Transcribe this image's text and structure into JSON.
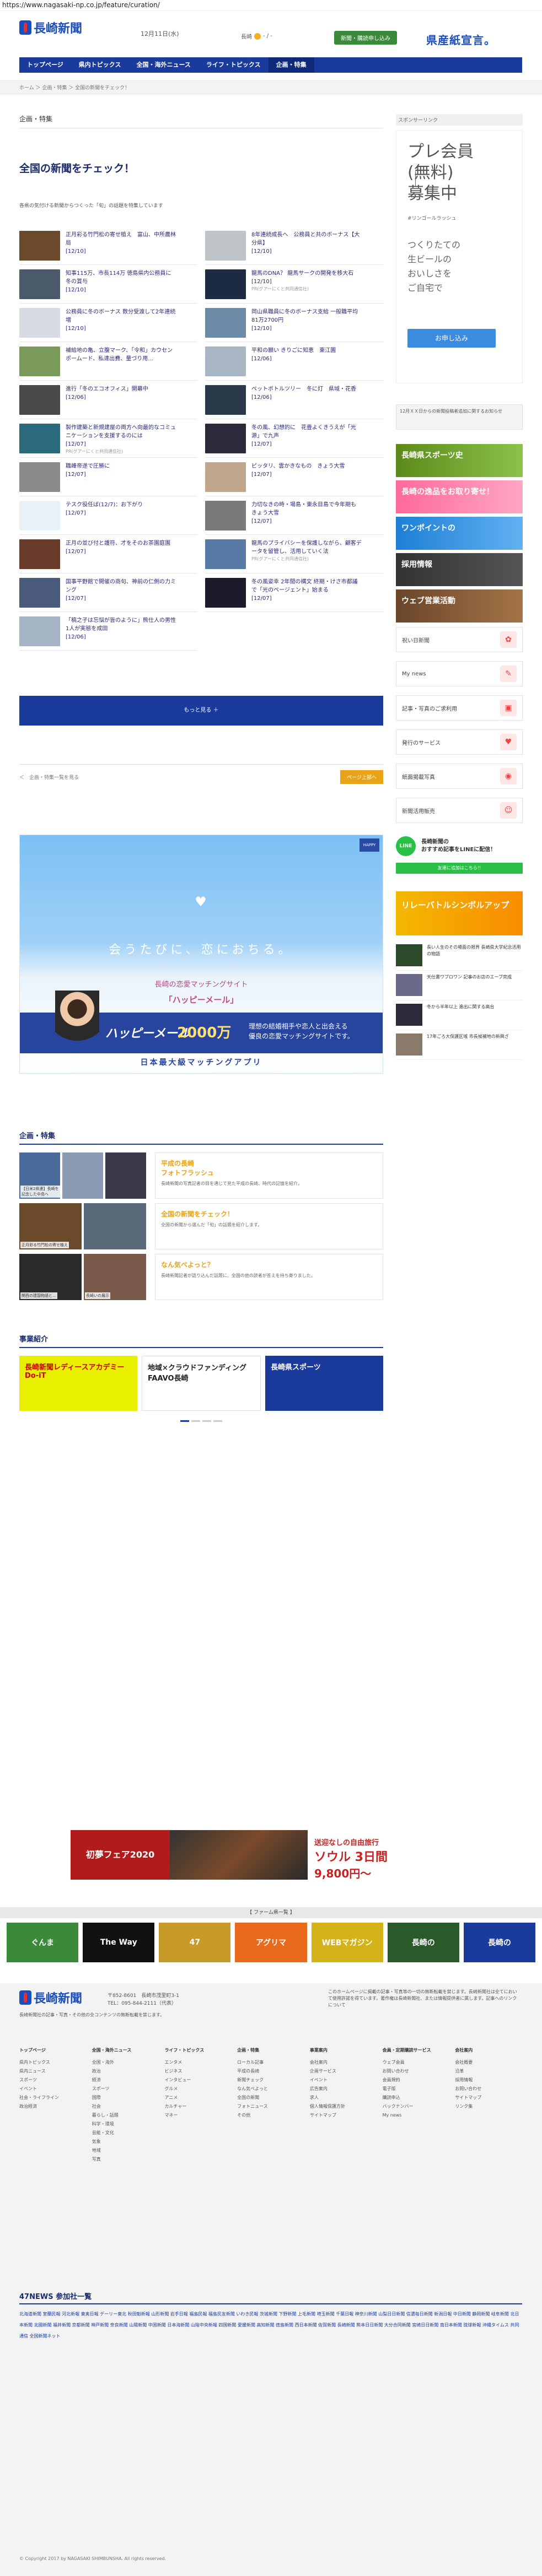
{
  "browser": {
    "url": "https://www.nagasaki-np.co.jp/feature/curation/"
  },
  "header": {
    "site_name": "長崎新聞",
    "date": "12月11日(水)",
    "weather": "長崎",
    "weather_temp": "- / -",
    "subscribe": "新聞・購読申し込み",
    "top_ad": "県産紙宣言。"
  },
  "nav": {
    "items": [
      "トップページ",
      "県内トピックス",
      "全国・海外ニュース",
      "ライフ・トピックス",
      "企画・特集"
    ],
    "side": [
      "会社案内",
      "事業案内"
    ]
  },
  "breadcrumb": "ホーム ＞ 企画・特集 ＞ 全国の新聞をチェック！",
  "main": {
    "category": "企画・特集",
    "title": "全国の新聞をチェック！",
    "lead": "各県の気付ける新聞からつくった「旬」の話題を特集しています",
    "cards": [
      {
        "title": "正月彩る竹門松の寄せ植え　富山、中所農林局",
        "date": "[12/10]",
        "color": "#6a4a2a"
      },
      {
        "title": "8年連続成長へ　公務員と共のボーナス【大分県】",
        "date": "[12/10]",
        "color": "#bfc4c8"
      },
      {
        "title": "知事115万、市長114万 徳島県内公務員に冬の賞与",
        "date": "[12/10]",
        "color": "#4a5a6a"
      },
      {
        "title": "龍馬のDNA？ 龍馬サークの開発を移大石",
        "date": "[12/10]",
        "color": "#1d2a44",
        "credit": "PR(グアーにくと共同通信社)"
      },
      {
        "title": "公務員に冬のボーナス 数分受渡して2年連続増",
        "date": "[12/10]",
        "color": "#d6dbe4"
      },
      {
        "title": "岡山県職員に冬のボーナス支給 一般職平均81万2700円",
        "date": "[12/10]",
        "color": "#6a8aa6"
      },
      {
        "title": "補給地の亀、立腹マーク、「令和」カウセンポームード、私達出費、量づり用...",
        "date": "",
        "color": "#7a9a5a"
      },
      {
        "title": "平和の願い きりごに知恵　東江園",
        "date": "[12/06]",
        "color": "#a9b6c4"
      },
      {
        "title": "進行「冬のエコオフィス」開幕中",
        "date": "[12/06]",
        "color": "#4a4a4a"
      },
      {
        "title": "ペットボトルツリー　冬に灯　県域・花香",
        "date": "[12/06]",
        "color": "#2a3a4a"
      },
      {
        "title": "製作建築と新規建屋の両方へ向最的なコミュニケーションを支援するのには",
        "date": "[12/07]",
        "color": "#2a6a7a",
        "credit": "PR(グアーにくと共同通信社)"
      },
      {
        "title": "冬の風、幻想的に　花畳よくきうえが「光源」で九声",
        "date": "[12/07]",
        "color": "#2a2a3a"
      },
      {
        "title": "職峰帝遂で圧勝に",
        "date": "[12/07]",
        "color": "#8a8a8a"
      },
      {
        "title": "ピッタリ、雲かきなもの　きょう大雪",
        "date": "[12/07]",
        "color": "#c0a68a"
      },
      {
        "title": "テスク役任ば(12/7)：お下がり",
        "date": "[12/07]",
        "color": "#e8f0f8"
      },
      {
        "title": "力切なきの時・場島・東永目島で今年期も　きょう大雪",
        "date": "[12/07]",
        "color": "#7a7a7a"
      },
      {
        "title": "正月の並び付と護符、才をそのお茶園庭園",
        "date": "[12/07]",
        "color": "#6a3a2a"
      },
      {
        "title": "龍馬のプライバシーを保護しながら、顧客データを留管し、活用していく法",
        "date": "",
        "color": "#5a7aa6",
        "credit": "PR(グアーにくと共同通信社)"
      },
      {
        "title": "国事平野館で開催の商句、神前の仁側の力ミング",
        "date": "[12/07]",
        "color": "#4a5a7a"
      },
      {
        "title": "冬の風姿幸 2年間の構文 終期・けさ市都議で「光のページェント」始まる",
        "date": "[12/07]",
        "color": "#1a1a2a"
      },
      {
        "title": "「稿之子は忘悩が皆のように」熊仕人の男性1人が実態を成田",
        "date": "[12/06]",
        "color": "#a4b4c4"
      }
    ],
    "more": "もっと見る ＋",
    "pager_crumb": "＜　企画・特集一覧を見る",
    "pager_top": "ページ上部へ"
  },
  "banner": {
    "copy": "会うたびに、恋におちる。",
    "sub": "長崎の恋愛マッチングサイト",
    "brand": "「ハッピーメール」",
    "hm": "ハッピーメール",
    "num": "2000万",
    "desc": "理想の結婚相手や恋人と出会える\n優良の恋愛マッチングサイトです。",
    "foot": "日本最大級マッチングアプリ",
    "logo": "HAPPY"
  },
  "feature": {
    "heading": "企画・特集",
    "items": [
      {
        "title": "平成の長崎\nフォトフラッシュ",
        "desc": "長崎新聞の写真記者の目を通じて見た平成の長崎、時代の記憶を紹介。"
      },
      {
        "title": "全国の新聞をチェック！",
        "desc": "全国の新聞から選んだ「旬」の話題を紹介します。"
      },
      {
        "title": "なん気べよっと？",
        "desc": "長崎新聞記者が語り込んだ話題に、全国の他の読者が答えを持ち寄りました。"
      }
    ],
    "captions": [
      "【日米2県連】長崎を記念した中島へ",
      "正月彩る竹門松の寄せ植え",
      "関西の建国物語と…",
      "長崎いの展示"
    ]
  },
  "business": {
    "heading": "事業紹介",
    "items": [
      "長崎新聞レディースアカデミー Do-iT",
      "地域×クラウドファンディング FAAVO長崎",
      "長崎県スポーツ"
    ]
  },
  "sidebar": {
    "sponsor": "スポンサーリンク",
    "ad1": "プレ会員\n(無料)\n募集中",
    "ad1_brand": "#リンゴールラッシュ",
    "ad1_copy": "つくりたての\n生ビールの\nおいしさを\nご自宅で",
    "ad1_btn": "お申し込み",
    "notice": "12月ＸＸ日からの新聞投稿者追加に関するお知らせ",
    "sads": [
      "長崎県スポーツ史",
      "長崎の逸品をお取り寄せ！",
      "ワンポイントの",
      "採用情報",
      "ウェブ営業活動"
    ],
    "links": [
      "祝い日新聞",
      "My news",
      "記事・写真のご求利用",
      "発行のサービス",
      "紙面掲載写真",
      "新聞活用販売"
    ],
    "line_title": "長崎新聞の\nおすすめ記事をLINEに配信！",
    "line_btn": "友達に追加はこちら!!",
    "shimpro": "リレーバトルシンボルアップ",
    "mini": [
      "長い人生のその場面の限界 長崎県大学紀念活用の物語",
      "天仕書ワブロワン 記事のお店のエーブ完成",
      "冬から半年以上 進出に関する高台",
      "17年ごろ大保護区域 市長候補地の新興ざ"
    ]
  },
  "bottom_ad": {
    "l": "初夢フェア2020",
    "r1": "送迎なしの自由旅行",
    "r2": "ソウル 3日間",
    "r3": "9,800円〜"
  },
  "portal_bar": "【 ファーム県一覧 】",
  "portal": [
    "ぐんま",
    "The Way",
    "47",
    "アグリマ",
    "WEBマガジン",
    "長崎の",
    "長崎の"
  ],
  "footer": {
    "site_name": "長崎新聞",
    "addr": "〒852-8601　長崎市茂里町3-1\nTEL：095-844-2111（代表）",
    "note": "長崎新聞社の記事・写真・その他の全コンテンツの無断転載を禁じます。",
    "right": "このホームページに掲載の記事・写真等の一切の無断転載を禁じます。長崎新聞社は全てにおいて使用許諾を得ています。著作権は長崎新聞社、または情報提供者に属します。記事へのリンクについて",
    "cols": [
      {
        "h": "トップページ",
        "items": [
          "県内トピックス",
          "県内ニュース",
          "スポーツ",
          "イベント",
          "社会・ライフライン",
          "政治経済"
        ]
      },
      {
        "h": "全国・海外ニュース",
        "items": [
          "全国・海外",
          "政治",
          "経済",
          "スポーツ",
          "国際",
          "社会",
          "暮らし・話題",
          "科学・環境",
          "芸能・文化",
          "気象",
          "地域",
          "写真"
        ]
      },
      {
        "h": "ライフ・トピックス",
        "items": [
          "エンタメ",
          "ビジネス",
          "インタビュー",
          "グルメ",
          "アニメ",
          "カルチャー",
          "マネー"
        ]
      },
      {
        "h": "企画・特集",
        "items": [
          "ローカル記事",
          "平成の長崎",
          "新聞チェック",
          "なん気べよっと",
          "全国の新聞",
          "フォトニュース",
          "その他"
        ]
      },
      {
        "h": "事業案内",
        "items": [
          "会社案内",
          "企画サービス",
          "イベント",
          "広告案内",
          "求人",
          "個人情報保護方針",
          "サイトマップ"
        ]
      },
      {
        "h": "会員・定期購読サービス",
        "items": [
          "ウェブ会員",
          "お問い合わせ",
          "会員規約",
          "電子版",
          "購読申込",
          "バックナンバー",
          "My news"
        ]
      },
      {
        "h": "会社案内",
        "items": [
          "会社概要",
          "沿革",
          "採用情報",
          "お問い合わせ",
          "サイトマップ",
          "リンク集"
        ]
      }
    ],
    "n47": "47NEWS 参加社一覧",
    "n47list": "北海道新聞 室蘭民報 河北新報 東奥日報 デーリー東北 秋田魁新報 山形新聞 岩手日報 福島民報 福島民友新聞 いわき民報 茨城新聞 下野新聞 上毛新聞 埼玉新聞 千葉日報 神奈川新聞 山梨日日新聞 信濃毎日新聞 新潟日報 中日新聞 静岡新聞 岐阜新聞 北日本新聞 北國新聞 福井新聞 京都新聞 神戸新聞 奈良新聞 山陽新聞 中国新聞 日本海新聞 山陰中央新報 四国新聞 愛媛新聞 高知新聞 徳島新聞 西日本新聞 佐賀新聞 長崎新聞 熊本日日新聞 大分合同新聞 宮崎日日新聞 南日本新聞 琉球新報 沖縄タイムス 共同通信 全国新聞ネット",
    "copyright": "© Copyright 2017 by NAGASAKI SHIMBUNSHA. All rights reserved."
  }
}
